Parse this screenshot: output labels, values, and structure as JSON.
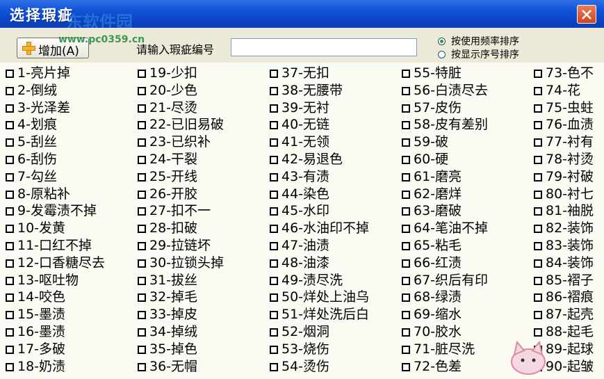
{
  "window": {
    "title": "选择瑕疵",
    "watermark_cn": "东软件园",
    "watermark_url": "www.pc0359.cn"
  },
  "toolbar": {
    "add_button_label": "增加(A)",
    "prompt_label": "请输入瑕疵编号",
    "code_input_value": "",
    "radio_sort_frequency": "按使用频率排序",
    "radio_sort_display": "按显示序号排序",
    "selected_sort": "frequency"
  },
  "defects": {
    "col1": [
      "1-亮片掉",
      "2-倒绒",
      "3-光泽差",
      "4-划痕",
      "5-刮丝",
      "6-刮伤",
      "7-勾丝",
      "8-原粘补",
      "9-发霉渍不掉",
      "10-发黄",
      "11-口红不掉",
      "12-口香糖尽去",
      "13-呕吐物",
      "14-咬色",
      "15-墨渍",
      "16-墨渍",
      "17-多破",
      "18-奶渍"
    ],
    "col2": [
      "19-少扣",
      "20-少色",
      "21-尽烫",
      "22-已旧易破",
      "23-已织补",
      "24-干裂",
      "25-开线",
      "26-开胶",
      "27-扣不一",
      "28-扣破",
      "29-拉链坏",
      "30-拉锁头掉",
      "31-拔丝",
      "32-掉毛",
      "33-掉皮",
      "34-掉绒",
      "35-掉色",
      "36-无帽"
    ],
    "col3": [
      "37-无扣",
      "38-无腰带",
      "39-无衬",
      "40-无链",
      "41-无领",
      "42-易退色",
      "43-有渍",
      "44-染色",
      "45-水印",
      "46-水油印不掉",
      "47-油渍",
      "48-油漆",
      "49-渍尽洗",
      "50-烊处上油乌",
      "51-烊处洗后白",
      "52-烟洞",
      "53-烧伤",
      "54-烫伤"
    ],
    "col4": [
      "55-特脏",
      "56-白渍尽去",
      "57-皮伤",
      "58-皮有差别",
      "59-破",
      "60-硬",
      "61-磨亮",
      "62-磨烊",
      "63-磨破",
      "64-笔油不掉",
      "65-粘毛",
      "66-红渍",
      "67-织后有印",
      "68-绿渍",
      "69-缩水",
      "70-胶水",
      "71-脏尽洗",
      "72-色差"
    ],
    "col5": [
      "73-色不",
      "74-花",
      "75-虫蛀",
      "76-血渍",
      "77-衬有",
      "78-衬烫",
      "79-衬破",
      "80-衬七",
      "81-袖脱",
      "82-装饰",
      "83-装饰",
      "84-装饰",
      "85-褶子",
      "86-褶痕",
      "87-起壳",
      "88-起毛",
      "89-起球",
      "90-起皱"
    ]
  }
}
